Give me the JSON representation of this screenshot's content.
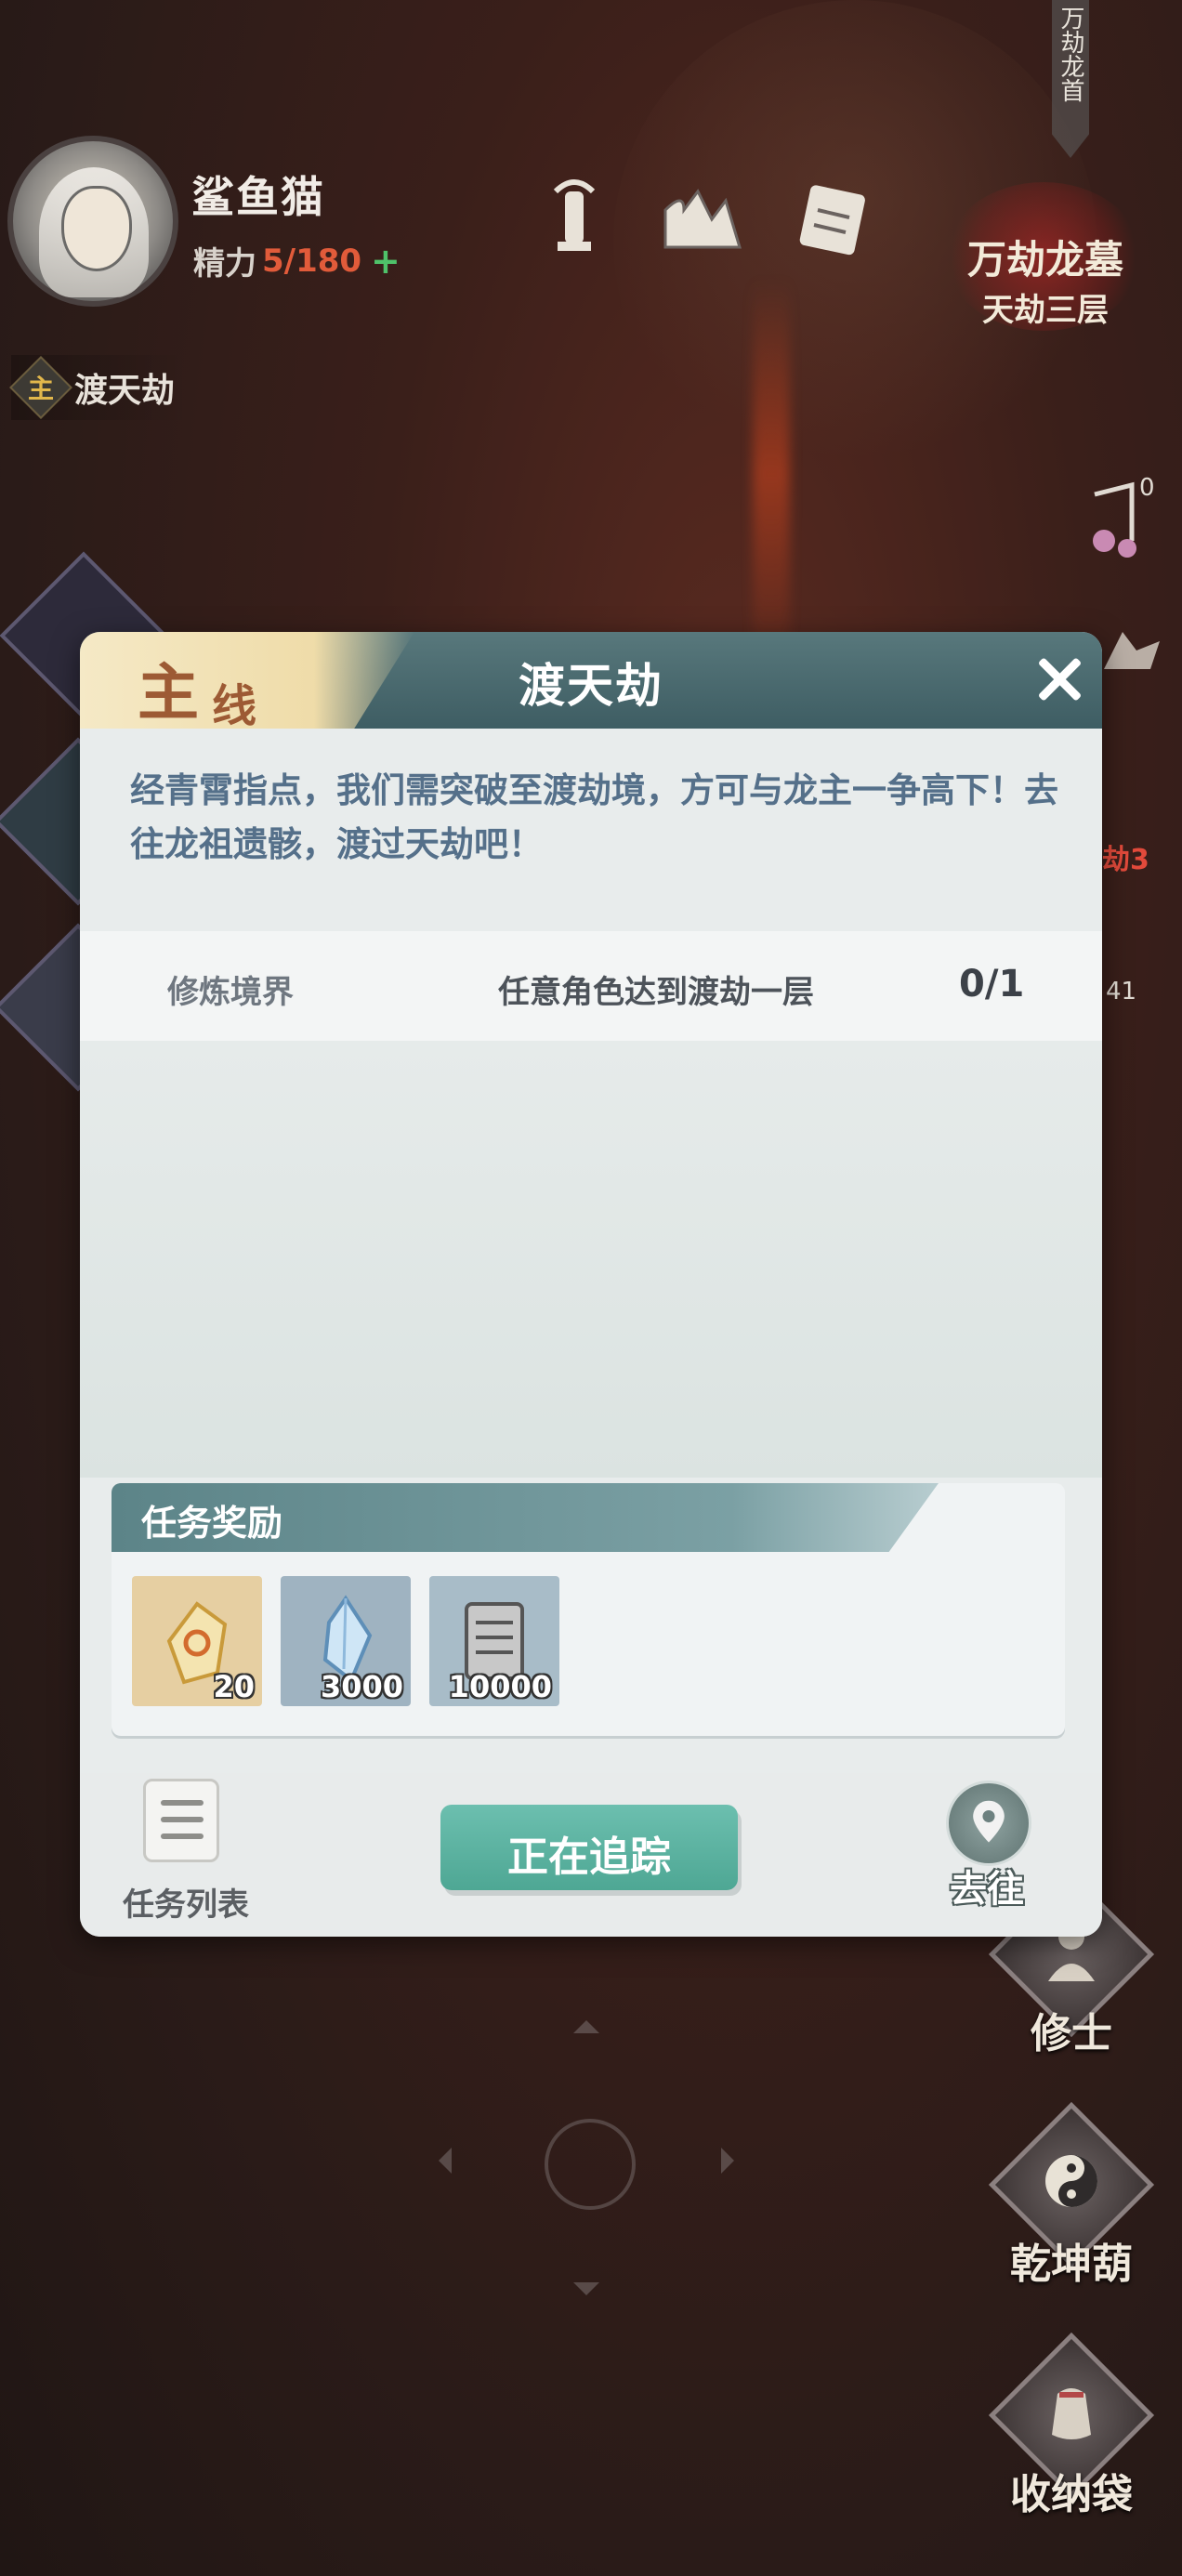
{
  "player": {
    "name": "鲨鱼猫",
    "stamina_label": "精力",
    "stamina_value": "5/180",
    "stamina_plus": "+"
  },
  "region": {
    "name": "万劫龙墓",
    "sub": "天劫三层",
    "side_tag": "万劫龙首"
  },
  "active_quest": {
    "marker": "主",
    "title": "渡天劫"
  },
  "right_hud": {
    "music_count": "0",
    "red_label": "劫3",
    "count_label": "41"
  },
  "side_menu": [
    {
      "label": "修士"
    },
    {
      "label": "乾坤葫"
    },
    {
      "label": "收纳袋"
    }
  ],
  "dialog": {
    "tag_main": "主",
    "tag_sub": "线",
    "title": "渡天劫",
    "description": "经青霄指点，我们需突破至渡劫境，方可与龙主一争高下！去往龙祖遗骸，渡过天劫吧！",
    "objective": {
      "category": "修炼境界",
      "text": "任意角色达到渡劫一层",
      "progress": "0/1"
    },
    "rewards_title": "任务奖励",
    "rewards": [
      {
        "icon": "talisman-crystal-icon",
        "qty": "20",
        "bg": "#e6cfa2"
      },
      {
        "icon": "blue-crystal-icon",
        "qty": "3000",
        "bg": "#9fb3c1"
      },
      {
        "icon": "scroll-icon",
        "qty": "10000",
        "bg": "#a8bcc8"
      }
    ],
    "list_label": "任务列表",
    "track_label": "正在追踪",
    "goto_label": "去往"
  }
}
